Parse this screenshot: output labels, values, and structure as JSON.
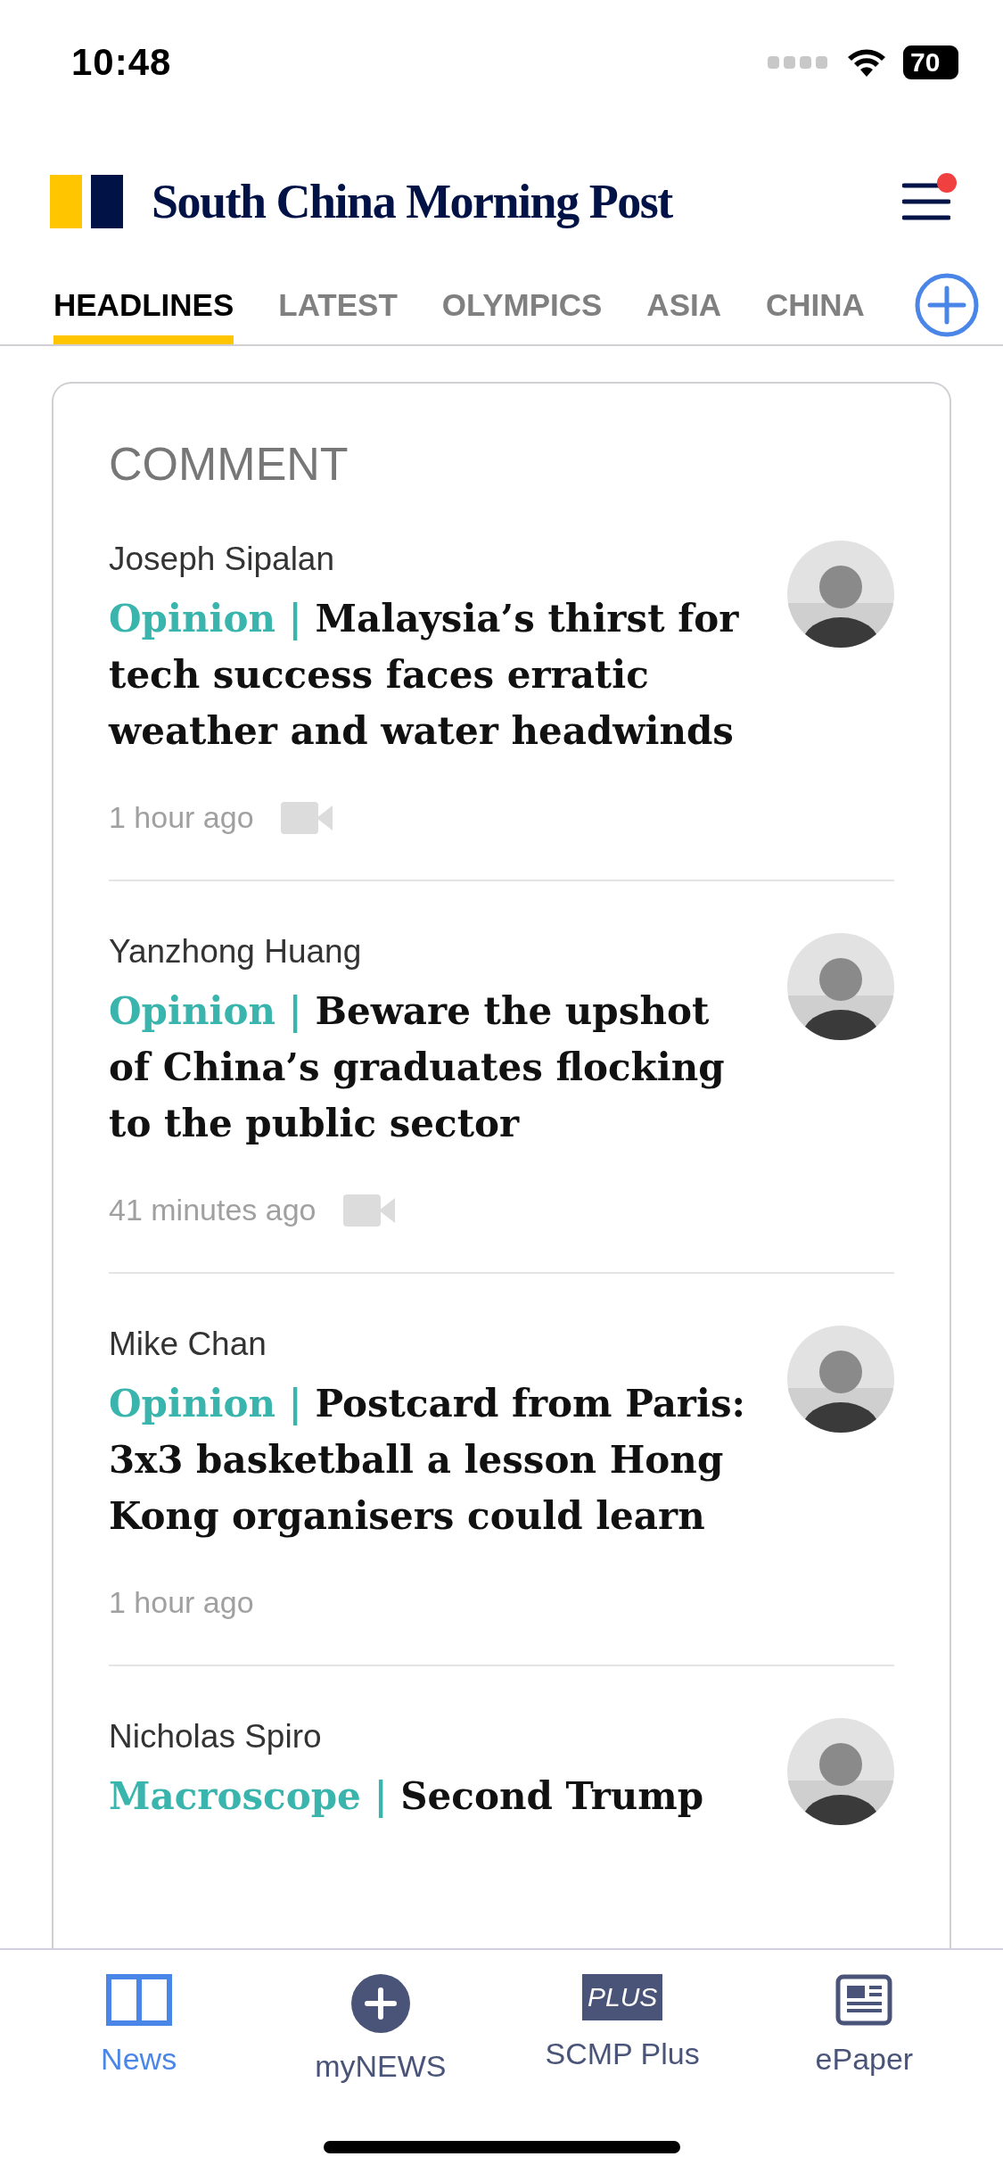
{
  "status_bar": {
    "time": "10:48",
    "battery": "70"
  },
  "brand": {
    "title": "South China Morning Post",
    "has_notification": true
  },
  "tabs": [
    {
      "label": "HEADLINES",
      "selected": true
    },
    {
      "label": "LATEST",
      "selected": false
    },
    {
      "label": "OLYMPICS",
      "selected": false
    },
    {
      "label": "ASIA",
      "selected": false
    },
    {
      "label": "CHINA",
      "selected": false
    }
  ],
  "section": {
    "title": "COMMENT",
    "articles": [
      {
        "author": "Joseph Sipalan",
        "label": "Opinion",
        "separator": "|",
        "title": "Malaysia’s thirst for tech success faces erratic weather and water headwinds",
        "time": "1 hour ago",
        "video": true
      },
      {
        "author": "Yanzhong Huang",
        "label": "Opinion",
        "separator": "|",
        "title": "Beware the upshot of China’s graduates flocking to the public sector",
        "time": "41 minutes ago",
        "video": true
      },
      {
        "author": "Mike Chan",
        "label": "Opinion",
        "separator": "|",
        "title": "Postcard from Paris: 3x3 basketball a lesson Hong Kong organisers could learn",
        "time": "1 hour ago",
        "video": false
      },
      {
        "author": "Nicholas Spiro",
        "label": "Macroscope",
        "separator": "|",
        "title": "Second Trump",
        "video": false
      }
    ]
  },
  "bottom_nav": [
    {
      "label": "News",
      "kind": "news",
      "selected": true
    },
    {
      "label": "myNEWS",
      "kind": "mynews",
      "selected": false
    },
    {
      "label": "SCMP Plus",
      "kind": "plus",
      "selected": false,
      "badge": "PLUS"
    },
    {
      "label": "ePaper",
      "kind": "epaper",
      "selected": false
    }
  ]
}
